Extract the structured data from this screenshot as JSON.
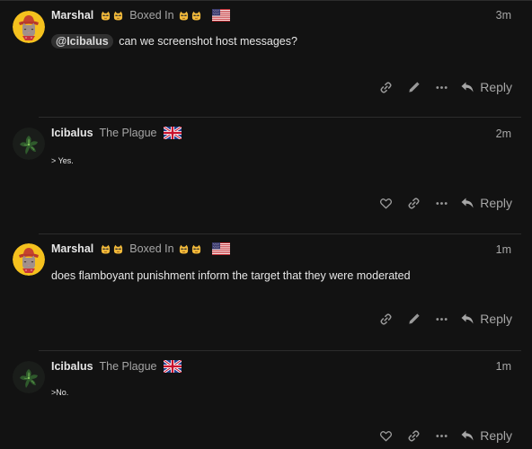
{
  "colors": {
    "background": "#121212",
    "text": "#e6e6e6",
    "muted": "#a6a6a6",
    "icon": "#9a9a9a",
    "divider": "#2c2c2c",
    "mention_bg": "#303030"
  },
  "posts": [
    {
      "username": "Marshal",
      "title": "Boxed In",
      "flag_icon": "us-flag-icon",
      "time": "3m",
      "mention": "@Icibalus",
      "text": "can we screenshot host messages?",
      "actions": [
        "link-icon",
        "pencil-icon",
        "more-icon"
      ],
      "reply_label": "Reply"
    },
    {
      "username": "Icibalus",
      "title": "The Plague",
      "flag_icon": "uk-flag-icon",
      "time": "2m",
      "text": "> Yes.",
      "actions": [
        "heart-icon",
        "link-icon",
        "more-icon"
      ],
      "reply_label": "Reply"
    },
    {
      "username": "Marshal",
      "title": "Boxed In",
      "flag_icon": "us-flag-icon",
      "time": "1m",
      "text": "does flamboyant punishment inform the target that they were moderated",
      "actions": [
        "link-icon",
        "pencil-icon",
        "more-icon"
      ],
      "reply_label": "Reply"
    },
    {
      "username": "Icibalus",
      "title": "The Plague",
      "flag_icon": "uk-flag-icon",
      "time": "1m",
      "text": ">No.",
      "actions": [
        "heart-icon",
        "link-icon",
        "more-icon"
      ],
      "reply_label": "Reply"
    }
  ]
}
